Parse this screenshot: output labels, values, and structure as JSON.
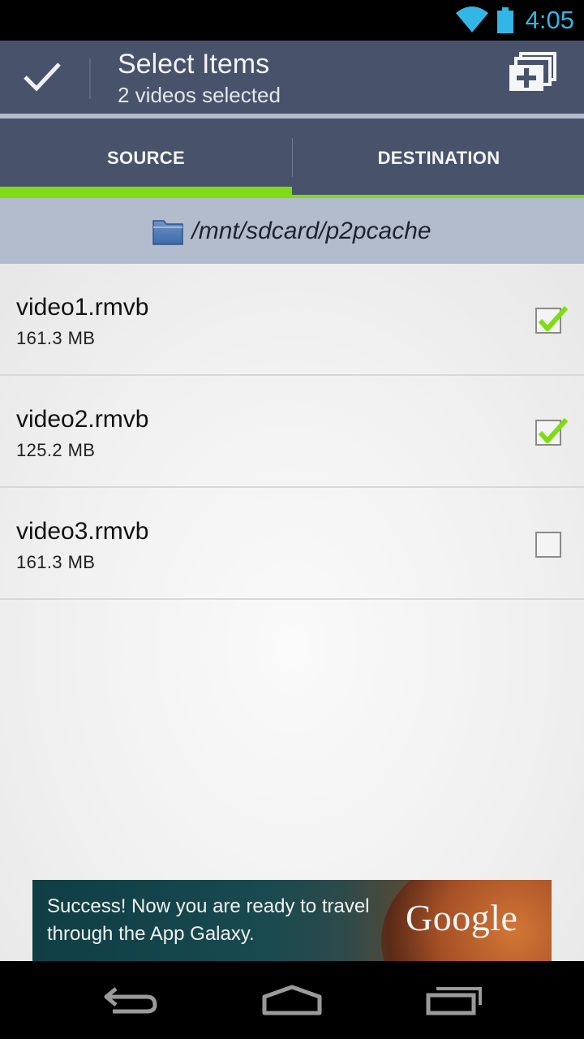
{
  "status_bar": {
    "time": "4:05",
    "wifi_icon": "wifi-icon",
    "battery_icon": "battery-icon",
    "accent_color": "#33b5e5"
  },
  "action_bar": {
    "title": "Select Items",
    "subtitle": "2 videos selected",
    "done_icon": "check-icon",
    "add_icon": "add-to-stack-icon",
    "background": "#48536b"
  },
  "tabs": [
    {
      "label": "SOURCE",
      "selected": true
    },
    {
      "label": "DESTINATION",
      "selected": false
    }
  ],
  "path_bar": {
    "path": "/mnt/sdcard/p2pcache",
    "icon": "folder-icon"
  },
  "files": [
    {
      "name": "video1.rmvb",
      "size": "161.3 MB",
      "checked": true
    },
    {
      "name": "video2.rmvb",
      "size": "125.2 MB",
      "checked": true
    },
    {
      "name": "video3.rmvb",
      "size": "161.3 MB",
      "checked": false
    }
  ],
  "ad": {
    "message": "Success! Now you are ready to travel through the App Galaxy.",
    "brand": "Google"
  },
  "nav_bar": {
    "back_icon": "back-icon",
    "home_icon": "home-icon",
    "recents_icon": "recents-icon"
  },
  "colors": {
    "accent_green": "#7fdc14",
    "tab_bg": "#48536b",
    "path_bg": "#b3bccd"
  }
}
